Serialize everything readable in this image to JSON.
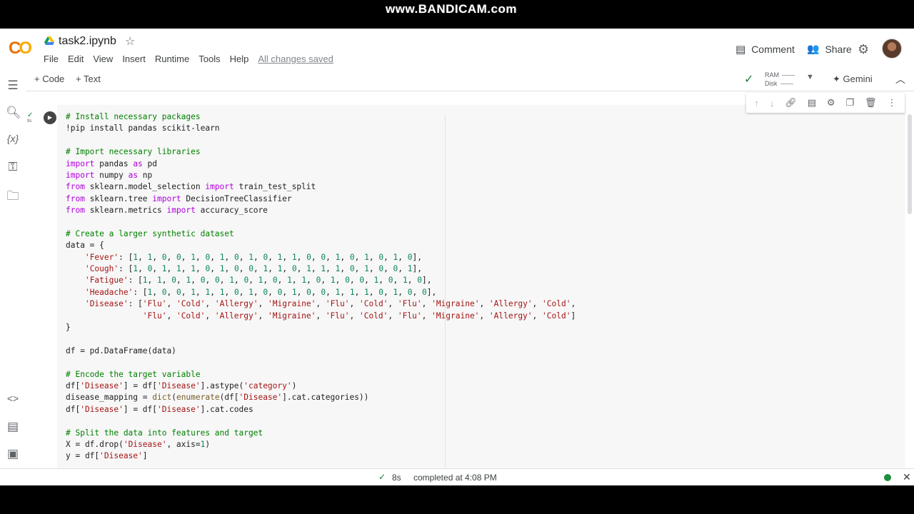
{
  "window": {
    "watermark": "www.BANDICAM.com"
  },
  "header": {
    "logo": "CO",
    "title": "task2.ipynb",
    "menu": [
      "File",
      "Edit",
      "View",
      "Insert",
      "Runtime",
      "Tools",
      "Help"
    ],
    "saved_status": "All changes saved",
    "comment_label": "Comment",
    "share_label": "Share"
  },
  "toolbar": {
    "add_code": "+ Code",
    "add_text": "+ Text",
    "ram_label": "RAM",
    "disk_label": "Disk",
    "gemini_label": "Gemini"
  },
  "cell": {
    "exec_time": "9s",
    "code_lines": [
      "# Install necessary packages",
      "!pip install pandas scikit-learn",
      "",
      "# Import necessary libraries",
      "import pandas as pd",
      "import numpy as np",
      "from sklearn.model_selection import train_test_split",
      "from sklearn.tree import DecisionTreeClassifier",
      "from sklearn.metrics import accuracy_score",
      "",
      "# Create a larger synthetic dataset",
      "data = {",
      "    'Fever': [1, 1, 0, 0, 1, 0, 1, 0, 1, 0, 1, 1, 0, 0, 1, 0, 1, 0, 1, 0],",
      "    'Cough': [1, 0, 1, 1, 1, 0, 1, 0, 0, 1, 1, 0, 1, 1, 1, 0, 1, 0, 0, 1],",
      "    'Fatigue': [1, 1, 0, 1, 0, 0, 1, 0, 1, 0, 1, 1, 0, 1, 0, 0, 1, 0, 1, 0],",
      "    'Headache': [1, 0, 0, 1, 1, 1, 0, 1, 0, 0, 1, 0, 0, 1, 1, 1, 0, 1, 0, 0],",
      "    'Disease': ['Flu', 'Cold', 'Allergy', 'Migraine', 'Flu', 'Cold', 'Flu', 'Migraine', 'Allergy', 'Cold',",
      "                'Flu', 'Cold', 'Allergy', 'Migraine', 'Flu', 'Cold', 'Flu', 'Migraine', 'Allergy', 'Cold']",
      "}",
      "",
      "df = pd.DataFrame(data)",
      "",
      "# Encode the target variable",
      "df['Disease'] = df['Disease'].astype('category')",
      "disease_mapping = dict(enumerate(df['Disease'].cat.categories))",
      "df['Disease'] = df['Disease'].cat.codes",
      "",
      "# Split the data into features and target",
      "X = df.drop('Disease', axis=1)",
      "y = df['Disease']"
    ]
  },
  "statusbar": {
    "duration": "8s",
    "message": "completed at 4:08 PM"
  },
  "colors": {
    "comment": "#008000",
    "keyword": "#af00db",
    "string": "#a31515",
    "number": "#098658",
    "accent_green": "#188038"
  }
}
